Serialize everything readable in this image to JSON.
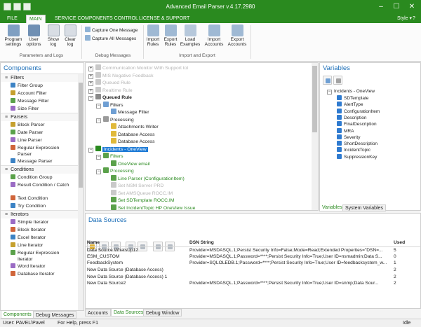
{
  "window": {
    "title": "Advanced Email Parser v.4.17.2980",
    "minimize_glyph": "–",
    "maximize_glyph": "☐",
    "close_glyph": "✕"
  },
  "ribbon": {
    "tabs": [
      "FILE",
      "MAIN",
      "SERVICE COMPONENTS CONTROL",
      "LICENSE & SUPPORT"
    ],
    "active_tab": "MAIN",
    "style_label": "Style",
    "help_glyph": "?",
    "buttons": {
      "program_settings": "Program settings",
      "user_options": "User options",
      "show_log": "Show log",
      "clear_log": "Clear log",
      "capture_one": "Capture One Message",
      "capture_all": "Capture All Messages",
      "import_rules": "Import Rules",
      "export_rules": "Export Rules",
      "load_examples": "Load Examples",
      "import_accounts": "Import Accounts",
      "export_accounts": "Export Accounts"
    },
    "groups": {
      "params": "Parameters and Logs",
      "debug": "Debug Messages",
      "import_export": "Import and Export"
    }
  },
  "components": {
    "title": "Components",
    "sections": [
      {
        "label": "Filters",
        "items": [
          "Filter Group",
          "Account Filter",
          "Message Filter",
          "Size Filter"
        ]
      },
      {
        "label": "Parsers",
        "items": [
          "Block Parser",
          "Date Parser",
          "Line Parser",
          "Regular Expression Parser",
          "Message Parser"
        ]
      },
      {
        "label": "Conditions",
        "items": [
          "Condition Group",
          "Result Condition / Catch",
          "Text Condition",
          "Try Condition"
        ]
      },
      {
        "label": "Iterators",
        "items": [
          "Simple Iterator",
          "Block Iterator",
          "Excel Iterator",
          "Line Iterator",
          "Regular Expression Iterator",
          "Word Iterator",
          "Database Iterator"
        ]
      }
    ],
    "tabs": [
      "Components",
      "Debug Messages"
    ]
  },
  "rules": {
    "nodes": [
      {
        "label": "Communication Monitor With Support tol",
        "style": "dim"
      },
      {
        "label": "MIS Negative Feedback",
        "style": "dim"
      },
      {
        "label": "Queued Rule",
        "style": "dim"
      },
      {
        "label": "Realtime Rule",
        "style": "dim"
      },
      {
        "label": "Queued Rule",
        "style": "bold"
      },
      {
        "label": "Filters",
        "style": ""
      },
      {
        "label": "Message Filter",
        "style": ""
      },
      {
        "label": "Processing",
        "style": ""
      },
      {
        "label": "Attachments Writer",
        "style": ""
      },
      {
        "label": "Database Access",
        "style": ""
      },
      {
        "label": "Database Access",
        "style": ""
      },
      {
        "label": "Incidents - OneView",
        "style": "sel"
      },
      {
        "label": "Filters",
        "style": "green"
      },
      {
        "label": "OneView email",
        "style": "green"
      },
      {
        "label": "Processing",
        "style": "green"
      },
      {
        "label": "Line Parser (ConfigurationItem)",
        "style": "green"
      },
      {
        "label": "Set NSM Server PRD",
        "style": "dim"
      },
      {
        "label": "Set AMSQueue ROCC.IM",
        "style": "dim"
      },
      {
        "label": "Set SDTemplate ROCC.IM",
        "style": "green"
      },
      {
        "label": "Set IncidentTopic HP OneView Issue",
        "style": "green"
      },
      {
        "label": "Set ShortDescription",
        "style": "green"
      }
    ]
  },
  "variables": {
    "title": "Variables",
    "root": "Incidents - OneView",
    "items": [
      "SDTemplate",
      "AlertType",
      "ConfigurationItem",
      "Description",
      "FinalDescription",
      "MRA",
      "Severity",
      "ShortDescription",
      "IncidentTopic",
      "SuppressionKey"
    ],
    "tabs": [
      "Variables",
      "System Variables"
    ]
  },
  "datasources": {
    "title": "Data Sources",
    "columns": [
      "Name",
      "DSN String",
      "Used"
    ],
    "rows": [
      {
        "name": "Data Source WhatsUp12",
        "dsn": "Provider=MSDASQL.1;Persist Security Info=False;Mode=Read;Extended Properties=\"DSN=...",
        "used": "5"
      },
      {
        "name": "ESM_CUSTOM",
        "dsn": "Provider=MSDASQL.1;Password=****;Persist Security Info=True;User ID=nsmadmin;Data S...",
        "used": "0"
      },
      {
        "name": "FeedbackSystem",
        "dsn": "Provider=SQLOLEDB.1;Password=****;Persist Security Info=True;User ID=feedbacksystem_w...",
        "used": "1"
      },
      {
        "name": "New Data Source (Database Access)",
        "dsn": "",
        "used": "2"
      },
      {
        "name": "New Data Source (Database Access) 1",
        "dsn": "",
        "used": "2"
      },
      {
        "name": "New Data Source2",
        "dsn": "Provider=MSDASQL.1;Password=****;Persist Security Info=True;User ID=snmp;Data Sour...",
        "used": "2"
      }
    ],
    "tabs": [
      "Accounts",
      "Data Sources",
      "Debug Window"
    ],
    "active_tab": "Data Sources"
  },
  "status": {
    "user": "User: PAVEL\\Pavel",
    "help": "For Help, press F1",
    "state": "Idle"
  },
  "colors": {
    "brand": "#2a8a1f",
    "accent": "#1d6fb8",
    "selection": "#1e7bd6"
  }
}
